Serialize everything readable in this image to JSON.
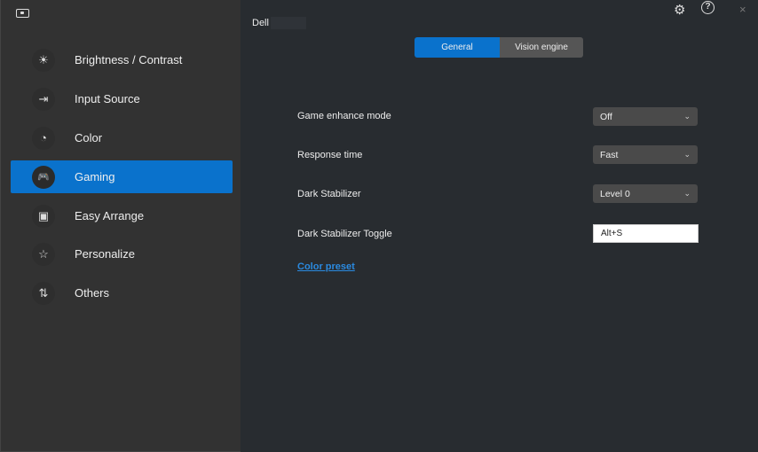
{
  "header": {
    "title": "Dell",
    "settings_icon": "gear-icon",
    "help_icon": "help-icon",
    "close_label": "×"
  },
  "sidebar": {
    "items": [
      {
        "label": "Brightness / Contrast",
        "icon": "☀"
      },
      {
        "label": "Input Source",
        "icon": "⇥"
      },
      {
        "label": "Color",
        "icon": "◔"
      },
      {
        "label": "Gaming",
        "icon": "🎮"
      },
      {
        "label": "Easy Arrange",
        "icon": "▣"
      },
      {
        "label": "Personalize",
        "icon": "☆"
      },
      {
        "label": "Others",
        "icon": "⇅"
      }
    ],
    "active": "Gaming"
  },
  "tabs": [
    {
      "label": "General"
    },
    {
      "label": "Vision engine"
    }
  ],
  "settings": {
    "game_enhance": {
      "label": "Game enhance mode",
      "value": "Off"
    },
    "response_time": {
      "label": "Response time",
      "value": "Fast"
    },
    "dark_stabilizer": {
      "label": "Dark Stabilizer",
      "value": "Level 0"
    },
    "toggle": {
      "label": "Dark Stabilizer Toggle",
      "value": "Alt+S"
    },
    "color_preset": "Color preset"
  },
  "colors": {
    "accent": "#0a72cc",
    "link": "#2a8ae0"
  }
}
